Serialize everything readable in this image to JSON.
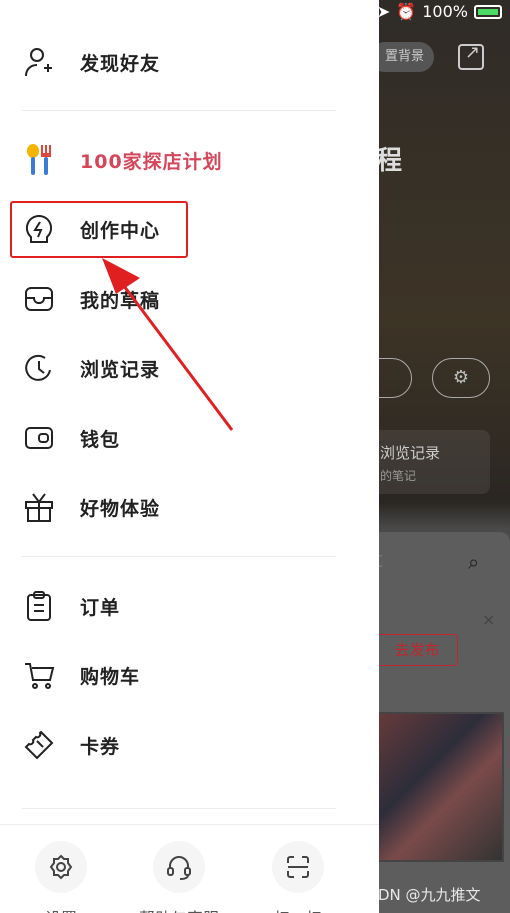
{
  "status_bar": {
    "battery": "100%"
  },
  "background": {
    "pill_text": "置背景",
    "title_char": "程",
    "card_title": "浏览记录",
    "card_sub": "的笔记",
    "search_label": "t",
    "publish_label": "去发布",
    "close_label": "×"
  },
  "drawer": {
    "items": [
      {
        "label": "发现好友"
      },
      {
        "label": "100家探店计划"
      },
      {
        "label": "创作中心"
      },
      {
        "label": "我的草稿"
      },
      {
        "label": "浏览记录"
      },
      {
        "label": "钱包"
      },
      {
        "label": "好物体验"
      },
      {
        "label": "订单"
      },
      {
        "label": "购物车"
      },
      {
        "label": "卡券"
      }
    ],
    "bottom": [
      {
        "label": "设置"
      },
      {
        "label": "帮助与客服"
      },
      {
        "label": "扫一扫"
      }
    ]
  },
  "watermark": "CSDN @九九推文",
  "colors": {
    "accent": "#d6465a",
    "highlight": "#e02020"
  }
}
